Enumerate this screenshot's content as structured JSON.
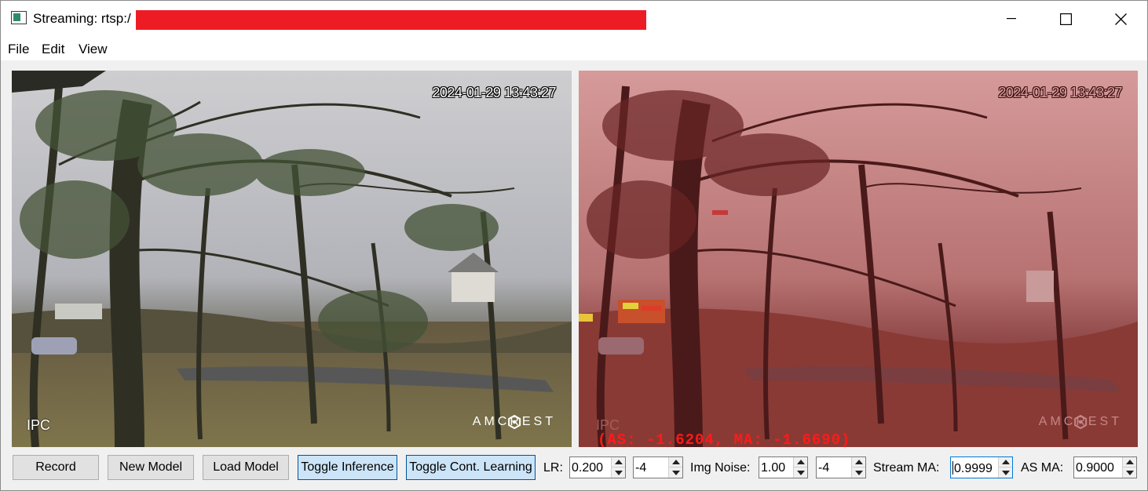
{
  "window": {
    "title": "Streaming: rtsp:/",
    "redacted": true,
    "controls": [
      "minimize-icon",
      "maximize-icon",
      "close-icon"
    ]
  },
  "menu": [
    "File",
    "Edit",
    "View"
  ],
  "video_left": {
    "timestamp": "2024-01-29 13:43:27",
    "camera_label": "IPC",
    "brand": "AMCREST"
  },
  "video_right": {
    "timestamp": "2024-01-29 13:43:27",
    "camera_label": "IPC",
    "brand": "AMCREST",
    "overlay": "(AS: -1.6204, MA: -1.6690)",
    "tint": "#a0282c"
  },
  "controls": {
    "record": "Record",
    "new_model": "New Model",
    "load_model": "Load Model",
    "toggle_inference": "Toggle Inference",
    "toggle_cont_learning": "Toggle Cont. Learning",
    "lr_label": "LR:",
    "lr_value": "0.200",
    "lr_exp": "-4",
    "img_noise_label": "Img Noise:",
    "img_noise_value": "1.00",
    "img_noise_exp": "-4",
    "stream_ma_label": "Stream MA:",
    "stream_ma_value": "0.9999",
    "as_ma_label": "AS MA:",
    "as_ma_value": "0.9000"
  },
  "colors": {
    "redaction": "#ed1c24",
    "toggle_bg": "#cce4f7",
    "toggle_border": "#005499",
    "overlay_text": "#ff1a1a"
  }
}
